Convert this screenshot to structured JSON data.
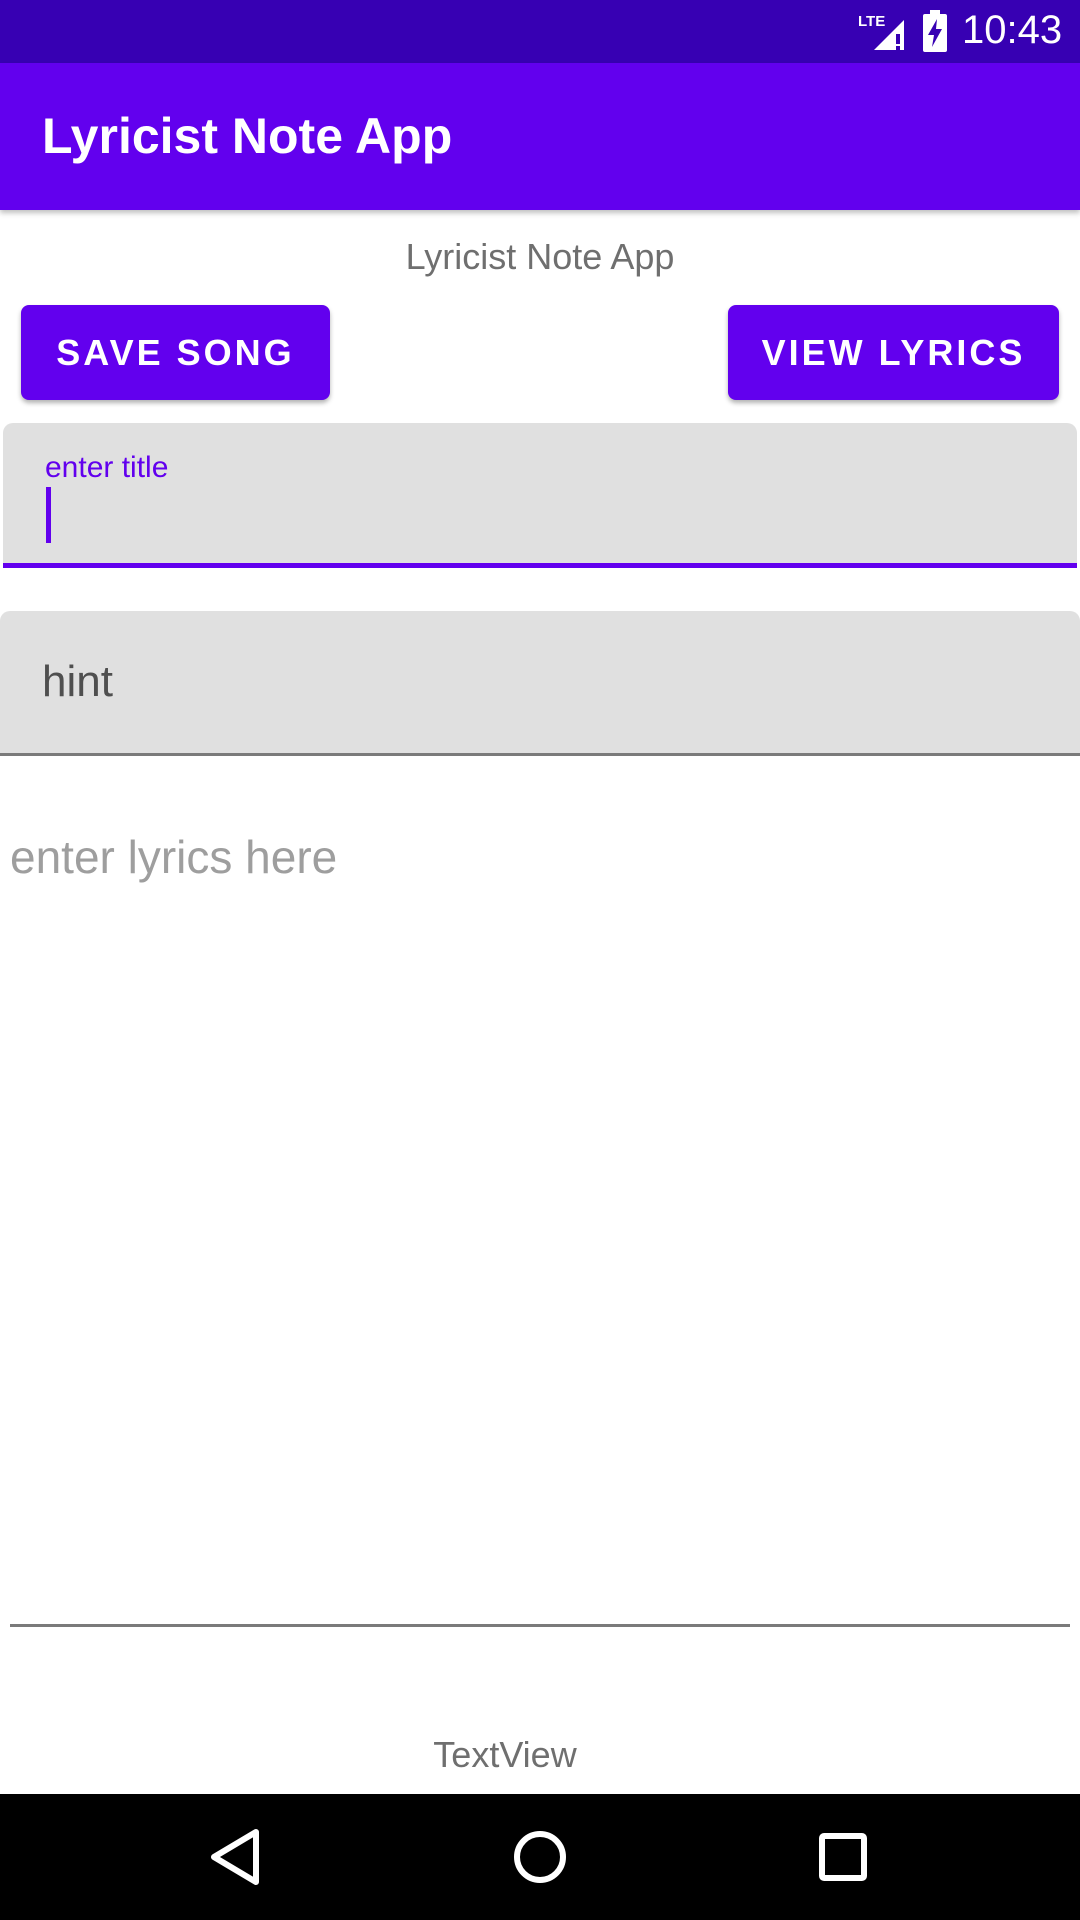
{
  "status_bar": {
    "network": "LTE",
    "time": "10:43",
    "icons": [
      "lte-signal-icon",
      "battery-charging-icon"
    ]
  },
  "app_bar": {
    "title": "Lyricist Note App",
    "color": "#6200ee"
  },
  "subtitle": "Lyricist Note App",
  "buttons": {
    "save_label": "SAVE SONG",
    "view_label": "VIEW LYRICS"
  },
  "title_input": {
    "label": "enter title",
    "value": ""
  },
  "hint_input": {
    "placeholder": "hint",
    "value": ""
  },
  "lyrics_input": {
    "placeholder": "enter lyrics here",
    "value": ""
  },
  "footer_text": "TextView",
  "nav_bar": {
    "icons": [
      "back-icon",
      "home-icon",
      "recents-icon"
    ]
  },
  "colors": {
    "status_bar": "#3700b3",
    "primary": "#6200ee",
    "field_background": "#e0e0e0"
  }
}
